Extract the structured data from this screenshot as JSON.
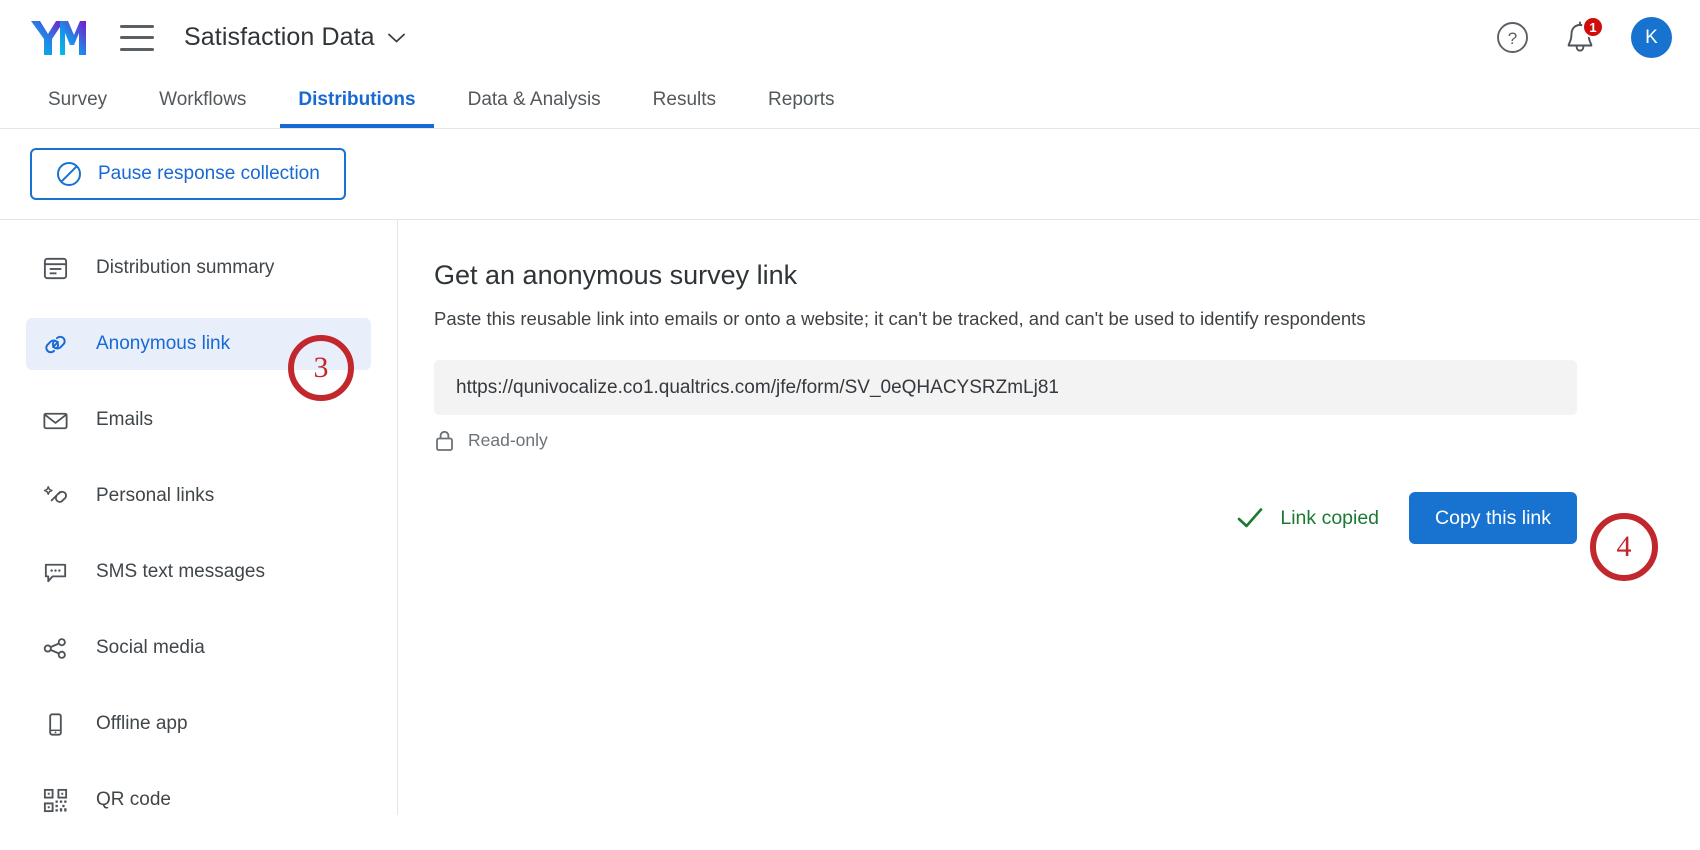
{
  "header": {
    "logo_alt": "XM",
    "menu_icon": "hamburger-icon",
    "project_title": "Satisfaction Data",
    "help_icon": "question-mark-icon",
    "notifications_icon": "bell-icon",
    "notification_count": "1",
    "avatar_initial": "K"
  },
  "tabs": [
    {
      "label": "Survey",
      "active": false
    },
    {
      "label": "Workflows",
      "active": false
    },
    {
      "label": "Distributions",
      "active": true
    },
    {
      "label": "Data & Analysis",
      "active": false
    },
    {
      "label": "Results",
      "active": false
    },
    {
      "label": "Reports",
      "active": false
    }
  ],
  "action_bar": {
    "pause_label": "Pause response collection",
    "pause_icon": "no-entry-icon"
  },
  "sidebar": {
    "items": [
      {
        "label": "Distribution summary",
        "icon": "summary-card-icon",
        "active": false
      },
      {
        "label": "Anonymous link",
        "icon": "link-chain-icon",
        "active": true
      },
      {
        "label": "Emails",
        "icon": "envelope-icon",
        "active": false
      },
      {
        "label": "Personal links",
        "icon": "magic-link-icon",
        "active": false
      },
      {
        "label": "SMS text messages",
        "icon": "chat-bubble-icon",
        "active": false
      },
      {
        "label": "Social media",
        "icon": "share-nodes-icon",
        "active": false
      },
      {
        "label": "Offline app",
        "icon": "mobile-phone-icon",
        "active": false
      },
      {
        "label": "QR code",
        "icon": "qr-code-icon",
        "active": false
      }
    ]
  },
  "main": {
    "title": "Get an anonymous survey link",
    "description": "Paste this reusable link into emails or onto a website; it can't be tracked, and can't be used to identify respondents",
    "survey_url": "https://qunivocalize.co1.qualtrics.com/jfe/form/SV_0eQHACYSRZmLj81",
    "readonly_label": "Read-only",
    "readonly_icon": "lock-icon",
    "copied_status": "Link copied",
    "copied_icon": "checkmark-icon",
    "copy_button_label": "Copy this link"
  },
  "annotations": [
    {
      "number": "3",
      "target": "anonymous-link-sidebar-item"
    },
    {
      "number": "4",
      "target": "copy-this-link-button"
    }
  ],
  "colors": {
    "brand_blue": "#1773cf",
    "active_tab_blue": "#1769d4",
    "sidebar_active_bg": "#e9eefb",
    "success_green": "#1a7a33",
    "badge_red": "#cf0d0d",
    "annotation_red": "#c1272d"
  }
}
